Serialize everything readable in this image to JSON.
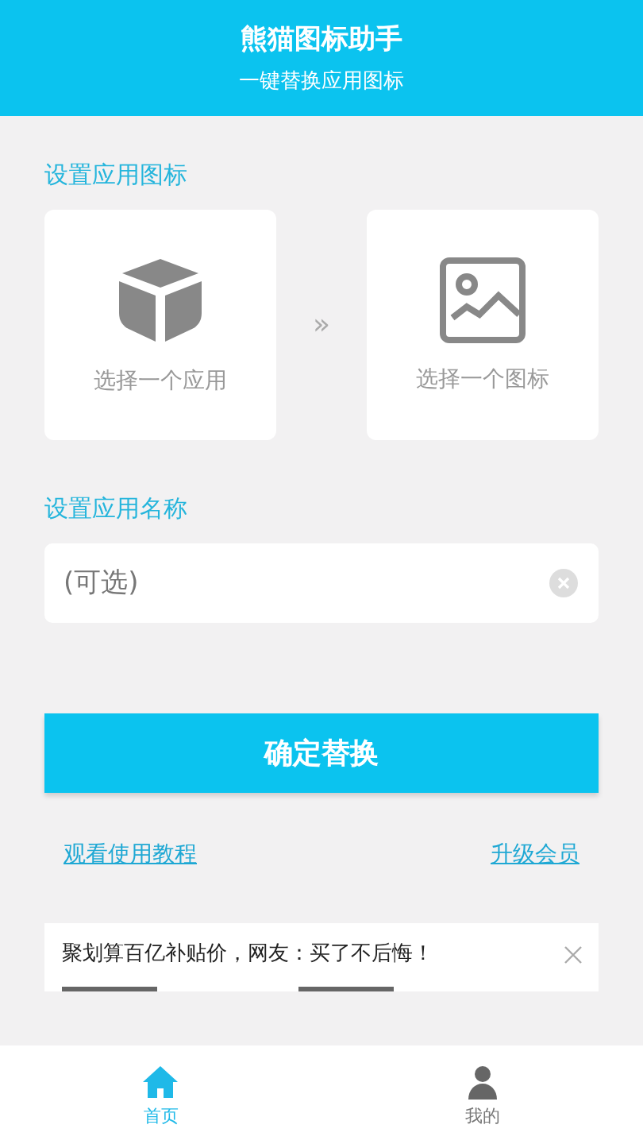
{
  "header": {
    "title": "熊猫图标助手",
    "subtitle": "一键替换应用图标"
  },
  "icon_section": {
    "label": "设置应用图标",
    "app_card": {
      "label": "选择一个应用"
    },
    "separator": "»",
    "icon_card": {
      "label": "选择一个图标"
    }
  },
  "name_section": {
    "label": "设置应用名称",
    "field": {
      "placeholder": "(可选)"
    }
  },
  "confirm_button": "确定替换",
  "links": [
    "观看使用教程",
    "升级会员"
  ],
  "ad": {
    "text": "聚划算百亿补贴价，网友：买了不后悔！"
  },
  "tabs": [
    {
      "label": "首页",
      "kind": "home",
      "selected": true
    },
    {
      "label": "我的",
      "kind": "person",
      "selected": false
    }
  ]
}
